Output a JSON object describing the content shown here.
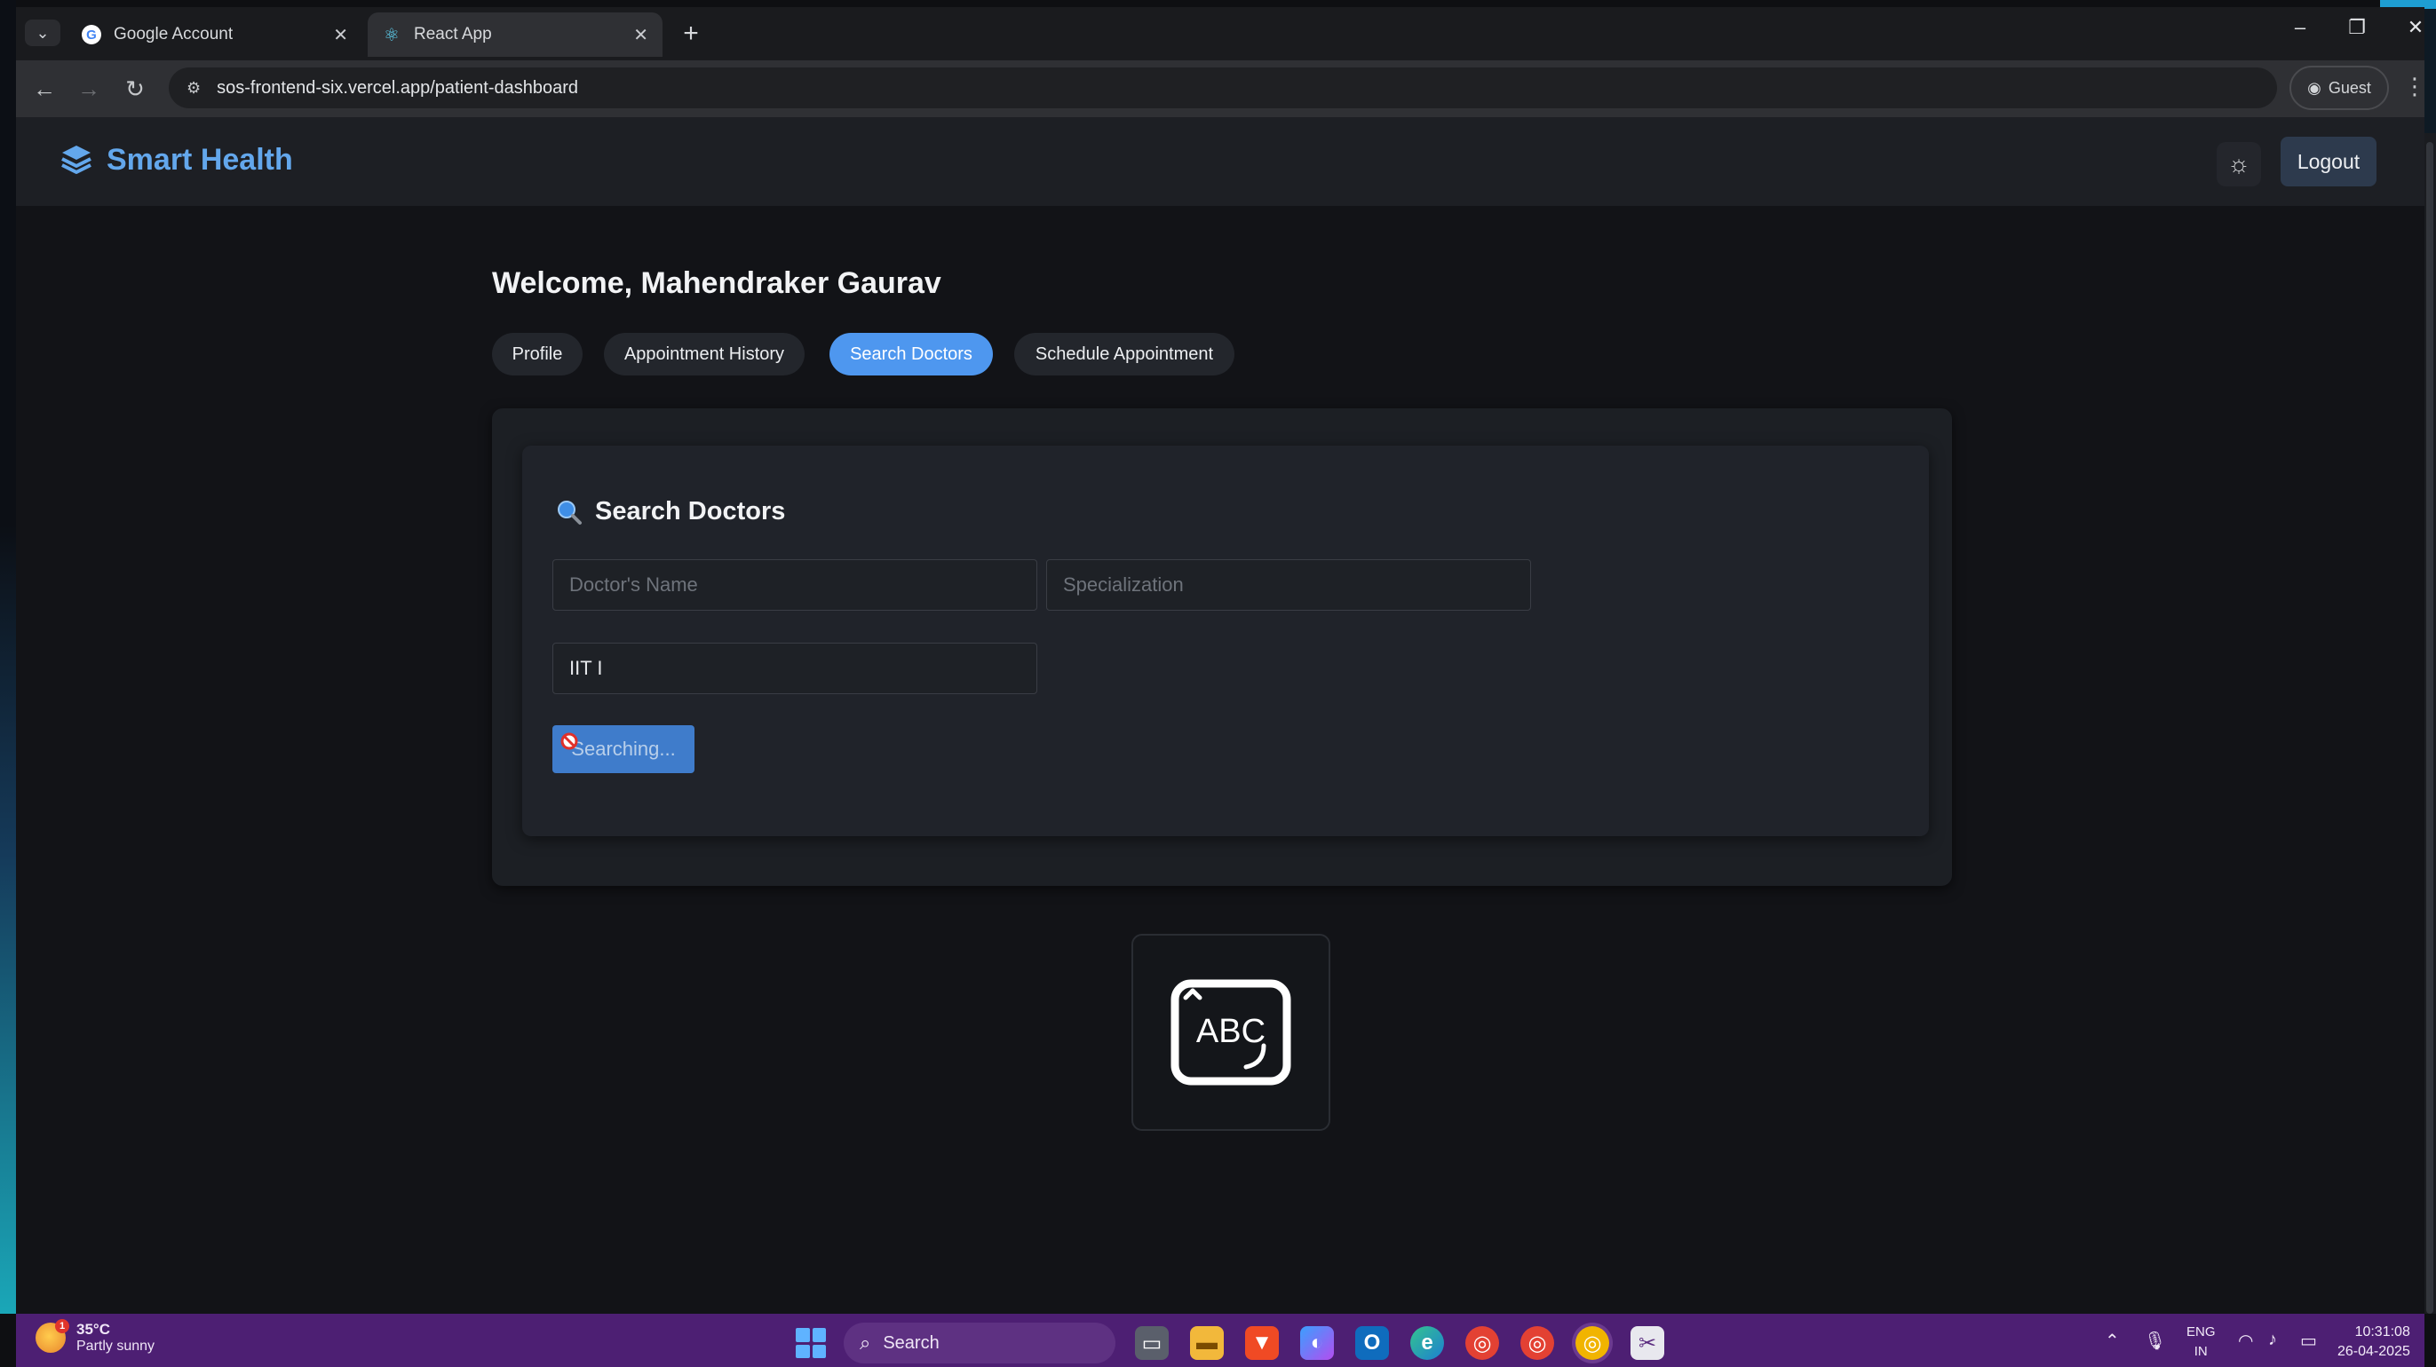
{
  "browser": {
    "tabs": [
      {
        "title": "Google Account",
        "active": false
      },
      {
        "title": "React App",
        "active": true
      }
    ],
    "url": "sos-frontend-six.vercel.app/patient-dashboard",
    "profile_label": "Guest"
  },
  "app": {
    "brand": "Smart Health",
    "logout_label": "Logout",
    "welcome": "Welcome, Mahendraker Gaurav",
    "nav_tabs": [
      {
        "label": "Profile",
        "active": false
      },
      {
        "label": "Appointment History",
        "active": false
      },
      {
        "label": "Search Doctors",
        "active": true
      },
      {
        "label": "Schedule Appointment",
        "active": false
      }
    ],
    "search": {
      "title": "Search Doctors",
      "name_placeholder": "Doctor's Name",
      "name_value": "",
      "specialization_placeholder": "Specialization",
      "specialization_value": "",
      "location_value": "IIT I",
      "button_label": "Searching..."
    },
    "keyboard_tile_text": "ABC"
  },
  "taskbar": {
    "weather_temp": "35°C",
    "weather_condition": "Partly sunny",
    "weather_badge": "1",
    "search_label": "Search",
    "lang_top": "ENG",
    "lang_bottom": "IN",
    "time": "10:31:08",
    "date": "26-04-2025"
  },
  "colors": {
    "accent": "#4e97ef",
    "brand": "#63a7ec",
    "taskbar": "#4d1f73"
  }
}
